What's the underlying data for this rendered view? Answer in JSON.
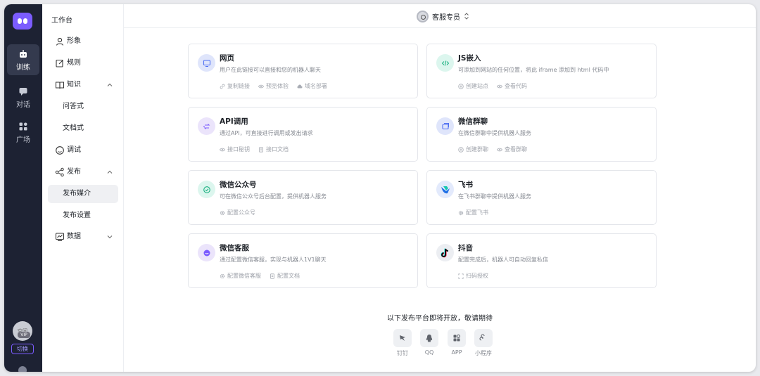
{
  "rail": {
    "items": [
      {
        "label": "训练",
        "active": true
      },
      {
        "label": "对话",
        "active": false
      },
      {
        "label": "广场",
        "active": false
      }
    ],
    "avatar_text": "空间",
    "vip_badge": "VIP",
    "switch_label": "切换"
  },
  "menu": {
    "title": "工作台",
    "items": [
      {
        "label": "形象",
        "icon": "user-icon"
      },
      {
        "label": "规则",
        "icon": "edit-icon"
      },
      {
        "label": "知识",
        "icon": "book-icon",
        "expanded": true
      },
      {
        "label": "问答式",
        "sub": true
      },
      {
        "label": "文档式",
        "sub": true
      },
      {
        "label": "调试",
        "icon": "chat-icon"
      },
      {
        "label": "发布",
        "icon": "share-icon",
        "expanded": true
      },
      {
        "label": "发布媒介",
        "sub": true,
        "selected": true
      },
      {
        "label": "发布设置",
        "sub": true
      },
      {
        "label": "数据",
        "icon": "chart-icon",
        "expanded": false
      }
    ]
  },
  "topbar": {
    "agent_name": "客服专员"
  },
  "cards": [
    {
      "title": "网页",
      "desc": "用户在此链接可以直接和您的机器人聊天",
      "icon": "monitor-icon",
      "icon_bg": "#dfe5fb",
      "icon_color": "#4e6ef2",
      "actions": [
        "复制链接",
        "预览体验",
        "域名部署"
      ]
    },
    {
      "title": "JS嵌入",
      "desc": "可添加到网站的任何位置，将此 iframe 添加到 html 代码中",
      "icon": "code-icon",
      "icon_bg": "#dcf6ee",
      "icon_color": "#18b07f",
      "actions": [
        "创建站点",
        "查看代码"
      ]
    },
    {
      "title": "API调用",
      "desc": "通过API，可直接进行调用或发出请求",
      "icon": "api-icon",
      "icon_bg": "#ebe4fb",
      "icon_color": "#7b5cff",
      "actions": [
        "接口秘钥",
        "接口文档"
      ]
    },
    {
      "title": "微信群聊",
      "desc": "在微信群聊中提供机器人服务",
      "icon": "group-chat-icon",
      "icon_bg": "#dfe5fb",
      "icon_color": "#4e6ef2",
      "actions": [
        "创建群聊",
        "查看群聊"
      ]
    },
    {
      "title": "微信公众号",
      "desc": "可在微信公众号后台配置，提供机器人服务",
      "icon": "wechat-official-icon",
      "icon_bg": "#dcf6ee",
      "icon_color": "#18b07f",
      "actions": [
        "配置公众号"
      ]
    },
    {
      "title": "飞书",
      "desc": "在飞书群聊中提供机器人服务",
      "icon": "feishu-icon",
      "icon_bg": "#e3eafc",
      "icon_color": "#1f6fe6",
      "actions": [
        "配置飞书"
      ]
    },
    {
      "title": "微信客服",
      "desc": "通过配置微信客服，实现与机器人1V1聊天",
      "icon": "wechat-service-icon",
      "icon_bg": "#ebe4fb",
      "icon_color": "#7b5cff",
      "actions": [
        "配置微信客服",
        "配置文档"
      ]
    },
    {
      "title": "抖音",
      "desc": "配置完成后，机器人可自动回复私信",
      "icon": "douyin-icon",
      "icon_bg": "#eceef2",
      "icon_color": "#111111",
      "actions": [
        "扫码授权"
      ]
    }
  ],
  "coming_soon": {
    "title": "以下发布平台即将开放，敬请期待",
    "items": [
      {
        "label": "钉钉",
        "icon": "dingtalk-icon"
      },
      {
        "label": "QQ",
        "icon": "qq-icon"
      },
      {
        "label": "APP",
        "icon": "app-icon"
      },
      {
        "label": "小程序",
        "icon": "miniprogram-icon"
      }
    ]
  },
  "colors": {
    "accent": "#7b5cff",
    "rail_bg": "#1d2233"
  }
}
